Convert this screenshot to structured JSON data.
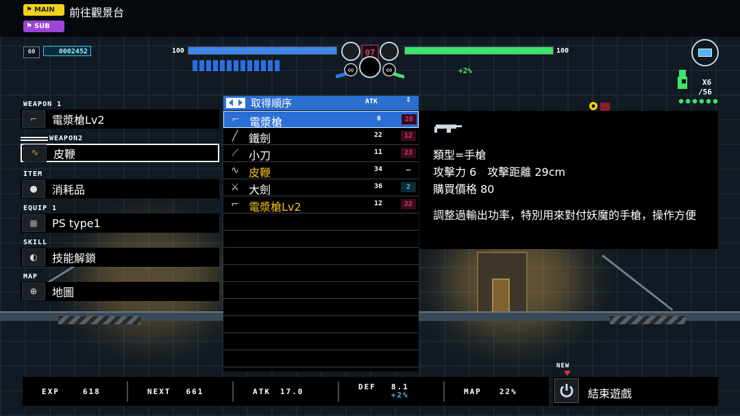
{
  "objective": {
    "main_tag": "MAIN",
    "sub_tag": "SUB",
    "main_text": "前往觀景台"
  },
  "hud": {
    "level": "60",
    "money": "0002452",
    "hp_left_max": "100",
    "hp_right_max": "100",
    "center_left_count": "00",
    "center_right_count": "00",
    "center_digits": "07",
    "bonus": "+2%",
    "lives_count": "X6",
    "lives_sub": "/56",
    "hp_left_fraction": 1.0,
    "hp_right_fraction": 1.0
  },
  "equipment": {
    "weapon1": {
      "label": "WEAPON 1",
      "value": "電漿槍Lv2",
      "icon": "pistol-icon"
    },
    "weapon2": {
      "label": "WEAPON2",
      "value": "皮鞭",
      "icon": "whip-icon"
    },
    "item": {
      "label": "ITEM",
      "value": "消耗品",
      "icon": "bomb-icon"
    },
    "equip1": {
      "label": "EQUIP 1",
      "value": "PS type1",
      "icon": "chip-icon"
    },
    "skill": {
      "label": "SKILL",
      "value": "技能解鎖",
      "icon": "arm-icon"
    },
    "map": {
      "label": "MAP",
      "value": "地圖",
      "icon": "map-pin-icon"
    }
  },
  "weapon_list": {
    "sort_label": "取得順序",
    "atk_header": "ATK",
    "rows": [
      {
        "name": "電漿槍",
        "atk": "6",
        "diff": "28",
        "icon": "pistol-icon",
        "name_color": "#ffffff",
        "diff_color": "#e0307a",
        "selected": true
      },
      {
        "name": "鐵劍",
        "atk": "22",
        "diff": "12",
        "icon": "sword-icon",
        "name_color": "#ffffff",
        "diff_color": "#e0307a",
        "selected": false
      },
      {
        "name": "小刀",
        "atk": "11",
        "diff": "23",
        "icon": "knife-icon",
        "name_color": "#ffffff",
        "diff_color": "#e0307a",
        "selected": false
      },
      {
        "name": "皮鞭",
        "atk": "34",
        "diff": "–",
        "icon": "whip-icon",
        "name_color": "#f2c21b",
        "diff_color": "#ffffff",
        "selected": false
      },
      {
        "name": "大劍",
        "atk": "36",
        "diff": "2",
        "icon": "greatsword-icon",
        "name_color": "#ffffff",
        "diff_color": "#36c6e6",
        "selected": false
      },
      {
        "name": "電漿槍Lv2",
        "atk": "12",
        "diff": "22",
        "icon": "pistol-icon",
        "name_color": "#f2c21b",
        "diff_color": "#e0307a",
        "selected": false
      }
    ]
  },
  "info": {
    "type_line": "類型=手槍",
    "atk_line": "攻擊力 6　攻擊距離 29cm",
    "price_line": "購買價格 80",
    "description": "調整過輸出功率，特別用來對付妖魔的手槍，操作方便"
  },
  "stats": {
    "exp_label": "EXP",
    "exp_value": "618",
    "next_label": "NEXT",
    "next_value": "661",
    "atk_label": "ATK",
    "atk_value": "17.0",
    "def_label": "DEF",
    "def_value": "8.1",
    "def_bonus": "+2%",
    "map_label": "MAP",
    "map_value": "22%"
  },
  "quit": {
    "new_tag": "NEW",
    "label": "結束遊戲",
    "icon": "power-icon"
  },
  "colors": {
    "accent_blue": "#2b6fd6",
    "hp_blue": "#3f86e6",
    "hp_green": "#3ee36a",
    "main_tag": "#f2d21b",
    "sub_tag": "#9b46d6"
  }
}
